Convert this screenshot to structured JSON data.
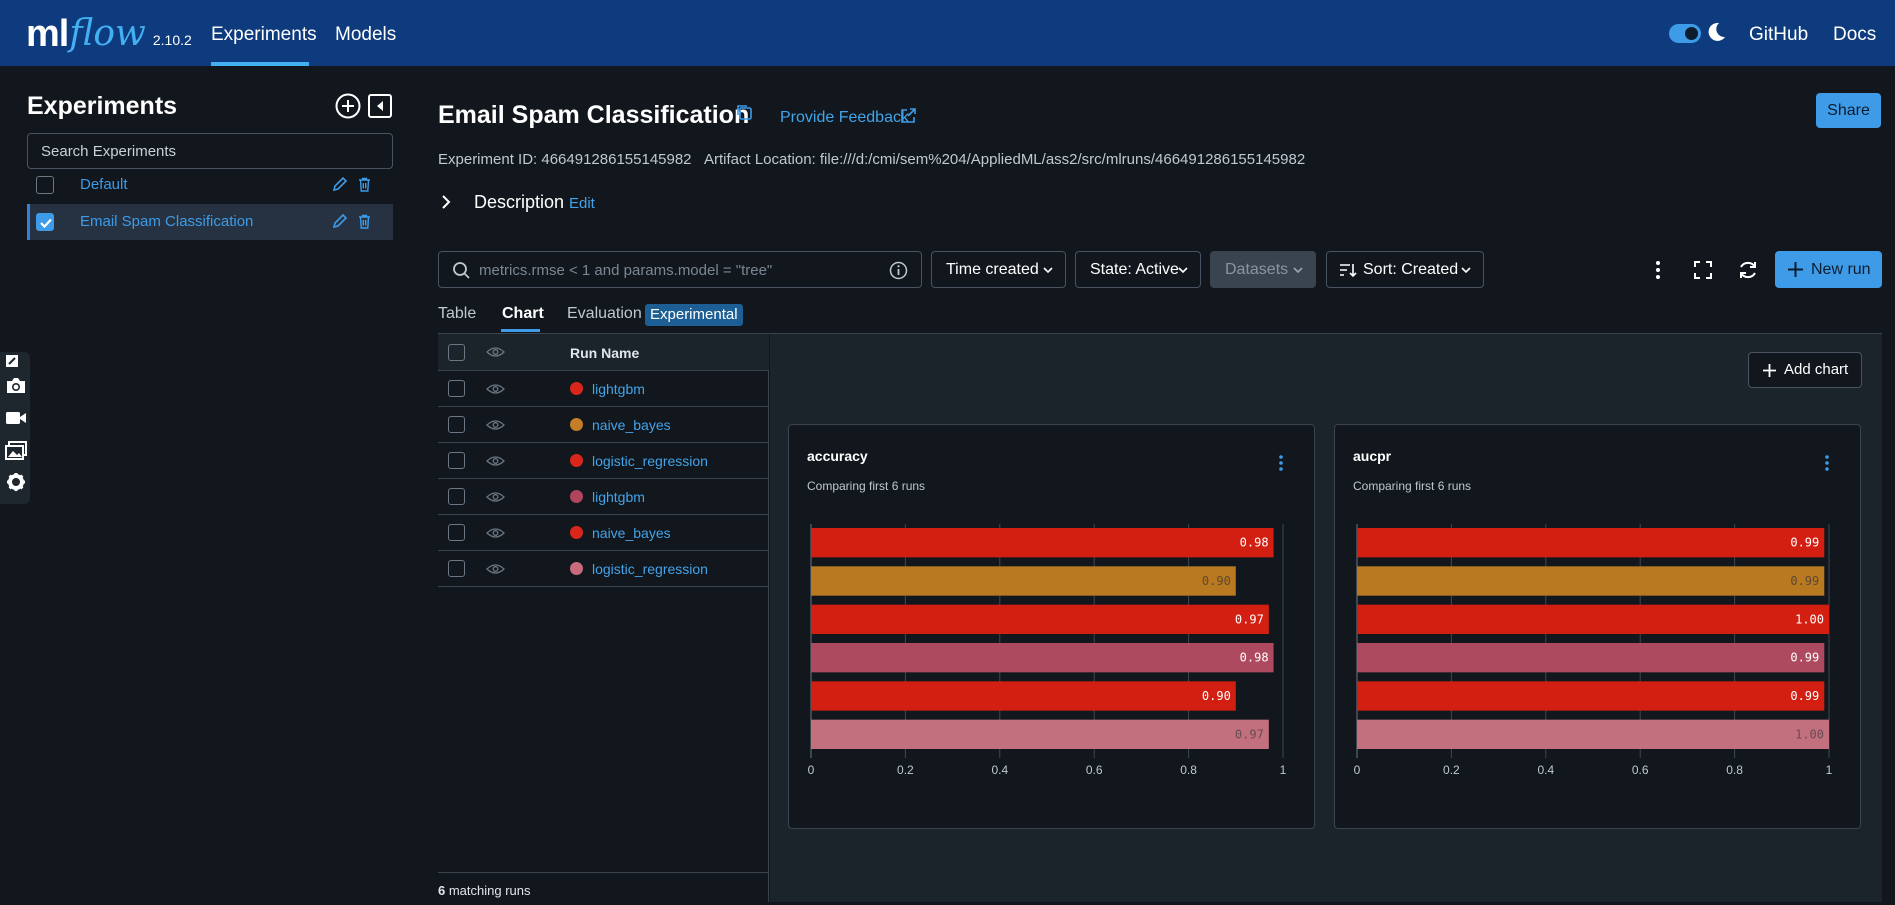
{
  "app": {
    "logo_ml": "ml",
    "logo_flow": "flow",
    "version": "2.10.2",
    "nav": [
      {
        "label": "Experiments",
        "active": true
      },
      {
        "label": "Models",
        "active": false
      }
    ],
    "links": [
      "GitHub",
      "Docs"
    ],
    "dark_mode": true
  },
  "sidebar": {
    "title": "Experiments",
    "search_placeholder": "Search Experiments",
    "experiments": [
      {
        "name": "Default",
        "selected": false
      },
      {
        "name": "Email Spam Classification",
        "selected": true
      }
    ]
  },
  "header": {
    "title": "Email Spam Classification",
    "feedback": "Provide Feedback",
    "share": "Share",
    "experiment_id": "Experiment ID: 466491286155145982",
    "artifact_location": "Artifact Location: file:///d:/cmi/sem%204/AppliedML/ass2/src/mlruns/466491286155145982",
    "description_label": "Description",
    "description_edit": "Edit"
  },
  "filters": {
    "search_placeholder": "metrics.rmse < 1 and params.model = \"tree\"",
    "time_created": "Time created",
    "state": "State: Active",
    "datasets": "Datasets",
    "sort": "Sort: Created",
    "new_run": "New run"
  },
  "tabs": [
    {
      "label": "Table",
      "active": false
    },
    {
      "label": "Chart",
      "active": true
    },
    {
      "label": "Evaluation",
      "active": false
    }
  ],
  "experimental_badge": "Experimental",
  "runs": {
    "header": "Run Name",
    "rows": [
      {
        "name": "lightgbm",
        "color": "#d8261b"
      },
      {
        "name": "naive_bayes",
        "color": "#c57d26"
      },
      {
        "name": "logistic_regression",
        "color": "#d8261b"
      },
      {
        "name": "lightgbm",
        "color": "#b0465e"
      },
      {
        "name": "naive_bayes",
        "color": "#d8261b"
      },
      {
        "name": "logistic_regression",
        "color": "#c86b7c"
      }
    ],
    "footer_count": "6",
    "footer_text": " matching runs"
  },
  "add_chart": "Add chart",
  "chart_data": [
    {
      "type": "bar",
      "orientation": "horizontal",
      "title": "accuracy",
      "subtitle": "Comparing first 6 runs",
      "xlim": [
        0,
        1
      ],
      "ticks": [
        "0",
        "0.2",
        "0.4",
        "0.6",
        "0.8",
        "1"
      ],
      "values": [
        0.98,
        0.9,
        0.97,
        0.98,
        0.9,
        0.97
      ],
      "labels": [
        "0.98",
        "0.90",
        "0.97",
        "0.98",
        "0.90",
        "0.97"
      ],
      "colors": [
        "#d21f12",
        "#b97921",
        "#d21f12",
        "#ae4a60",
        "#d21f12",
        "#c2707e"
      ],
      "label_colors": [
        "#ffffff",
        "#5b4a30",
        "#ffffff",
        "#ffffff",
        "#ffffff",
        "#6b4a52"
      ]
    },
    {
      "type": "bar",
      "orientation": "horizontal",
      "title": "aucpr",
      "subtitle": "Comparing first 6 runs",
      "xlim": [
        0,
        1
      ],
      "ticks": [
        "0",
        "0.2",
        "0.4",
        "0.6",
        "0.8",
        "1"
      ],
      "values": [
        0.99,
        0.99,
        1.0,
        0.99,
        0.99,
        1.0
      ],
      "labels": [
        "0.99",
        "0.99",
        "1.00",
        "0.99",
        "0.99",
        "1.00"
      ],
      "colors": [
        "#d21f12",
        "#b97921",
        "#d21f12",
        "#ae4a60",
        "#d21f12",
        "#c2707e"
      ],
      "label_colors": [
        "#ffffff",
        "#5b4a30",
        "#ffffff",
        "#ffffff",
        "#ffffff",
        "#6b4a52"
      ]
    }
  ]
}
